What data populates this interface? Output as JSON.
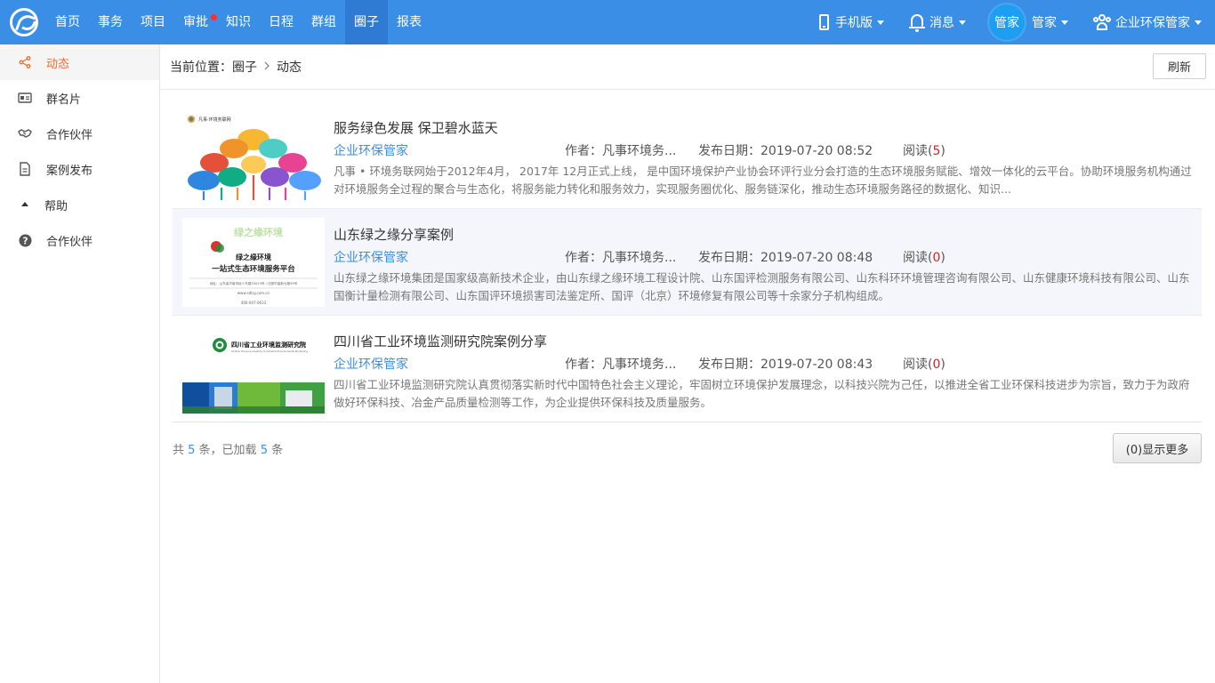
{
  "nav": {
    "items": [
      {
        "label": "首页"
      },
      {
        "label": "事务"
      },
      {
        "label": "项目"
      },
      {
        "label": "审批"
      },
      {
        "label": "知识"
      },
      {
        "label": "日程"
      },
      {
        "label": "群组"
      },
      {
        "label": "圈子"
      },
      {
        "label": "报表"
      }
    ],
    "active": "圈子",
    "mobile_label": "手机版",
    "messages_label": "消息",
    "avatar_text": "管家",
    "user_name": "管家",
    "org_name": "企业环保管家"
  },
  "sidebar": {
    "items": [
      {
        "label": "动态",
        "icon": "share-icon"
      },
      {
        "label": "群名片",
        "icon": "card-icon"
      },
      {
        "label": "合作伙伴",
        "icon": "handshake-icon"
      },
      {
        "label": "案例发布",
        "icon": "document-icon"
      },
      {
        "label": "帮助",
        "icon": "caret-up-icon"
      },
      {
        "label": "合作伙伴",
        "icon": "help-circle-icon"
      }
    ]
  },
  "breadcrumb": {
    "prefix": "当前位置：",
    "level1": "圈子",
    "level2": "动态"
  },
  "refresh_label": "刷新",
  "posts": [
    {
      "title": "服务绿色发展 保卫碧水蓝天",
      "org": "企业环保管家",
      "author": "作者：凡事环境务...",
      "date": "发布日期：2019-07-20 08:52",
      "read_label": "阅读",
      "read_count": "5",
      "desc": "凡事 • 环境务联网始于2012年4月， 2017年 12月正式上线， 是中国环境保护产业协会环评行业分会打造的生态环境服务赋能、增效一体化的云平台。协助环境服务机构通过对环境服务全过程的聚合与生态化，将服务能力转化和服务效力，实现服务圈优化、服务链深化，推动生态环境服务路径的数据化、知识...",
      "thumb_caption": "凡事·环境务联网"
    },
    {
      "title": "山东绿之缘分享案例",
      "org": "企业环保管家",
      "author": "作者：凡事环境务...",
      "date": "发布日期：2019-07-20 08:48",
      "read_label": "阅读",
      "read_count": "0",
      "desc": "山东绿之缘环境集团是国家级高新技术企业，由山东绿之缘环境工程设计院、山东国评检测服务有限公司、山东科环环境管理咨询有限公司、山东健康环境科技有限公司、山东国衡计量检测有限公司、山东国评环境损害司法鉴定所、国评（北京）环境修复有限公司等十余家分子机构组成。",
      "thumb_title": "绿之缘环境",
      "thumb_line1": "绿之缘环境",
      "thumb_line2": "一站式生态环境服务平台",
      "thumb_addr": "地址：山东省济南市经十东路33023号 / 日照市高新七路99号",
      "thumb_web": "www.sdlzy.com.cn",
      "thumb_tel": "400-007-0633"
    },
    {
      "title": "四川省工业环境监测研究院案例分享",
      "org": "企业环保管家",
      "author": "作者：凡事环境务...",
      "date": "发布日期：2019-07-20 08:43",
      "read_label": "阅读",
      "read_count": "0",
      "desc": "四川省工业环境监测研究院认真贯彻落实新时代中国特色社会主义理论，牢固树立环境保护发展理念，以科技兴院为己任，以推进全省工业环保科技进步为宗旨，致力于为政府做好环保科技、冶金产品质量检测等工作，为企业提供环保科技及质量服务。",
      "thumb_title": "四川省工业环境监测研究院",
      "thumb_sub": "Sichuan Province Academy of Industrial Environmental Monitoring"
    }
  ],
  "footer": {
    "count_prefix": "共 ",
    "total": "5",
    "count_mid": " 条，已加载 ",
    "loaded": "5",
    "count_suffix": " 条",
    "more_label": "(0)显示更多"
  },
  "colors": {
    "topbar": "#3a8ee6",
    "active_nav": "#2f7bd3",
    "active_side": "#f56c2c",
    "link": "#3a8ee6",
    "read_count": "#e02020"
  }
}
